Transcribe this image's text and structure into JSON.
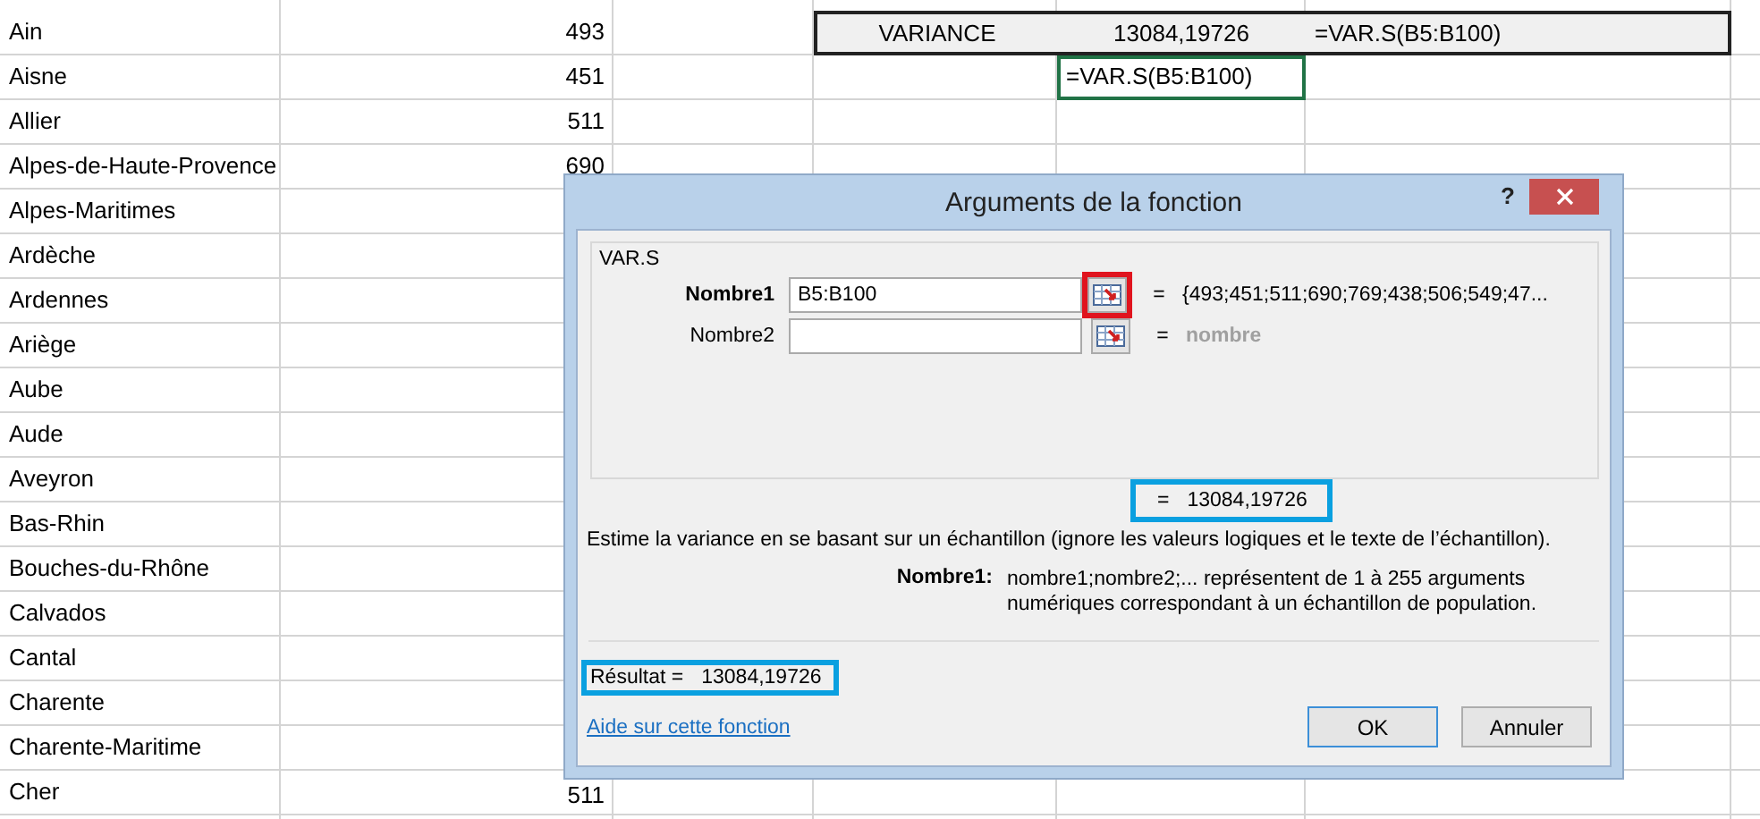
{
  "sheet": {
    "rows": [
      {
        "name": "Ain",
        "value": "493"
      },
      {
        "name": "Aisne",
        "value": "451"
      },
      {
        "name": "Allier",
        "value": "511"
      },
      {
        "name": "Alpes-de-Haute-Provence",
        "value": "690"
      },
      {
        "name": "Alpes-Maritimes"
      },
      {
        "name": "Ardèche"
      },
      {
        "name": "Ardennes"
      },
      {
        "name": "Ariège"
      },
      {
        "name": "Aube"
      },
      {
        "name": "Aude"
      },
      {
        "name": "Aveyron"
      },
      {
        "name": "Bas-Rhin"
      },
      {
        "name": "Bouches-du-Rhône"
      },
      {
        "name": "Calvados"
      },
      {
        "name": "Cantal"
      },
      {
        "name": "Charente"
      },
      {
        "name": "Charente-Maritime"
      },
      {
        "name": "Cher",
        "value": "511"
      }
    ],
    "summary": {
      "label": "VARIANCE",
      "value": "13084,19726",
      "formula": "=VAR.S(B5:B100)"
    },
    "edit_cell": {
      "text": "=VAR.S(B5:B100)",
      "selected": true
    }
  },
  "dialog": {
    "title": "Arguments de la fonction",
    "help": "?",
    "function_name": "VAR.S",
    "arguments": [
      {
        "label": "Nombre1",
        "value": "B5:B100",
        "active": true,
        "equals": "=",
        "result": "{493;451;511;690;769;438;506;549;47...",
        "result_muted": false,
        "highlighted": true
      },
      {
        "label": "Nombre2",
        "active": false,
        "equals": "=",
        "result": "nombre",
        "result_muted": true,
        "highlighted": false
      }
    ],
    "formula_result": {
      "equals": "=",
      "value": "13084,19726",
      "highlighted": true
    },
    "description": "Estime la variance en se basant sur un échantillon (ignore les valeurs logiques et le texte de l’échantillon).",
    "argument_help": {
      "label": "Nombre1:",
      "text": "nombre1;nombre2;... représentent de 1 à 255 arguments numériques correspondant à un échantillon de population."
    },
    "result": {
      "label": "Résultat =",
      "value": "13084,19726",
      "highlighted": true
    },
    "help_link": "Aide sur cette fonction",
    "buttons": [
      {
        "label": "OK",
        "default": true
      },
      {
        "label": "Annuler",
        "default": false
      }
    ]
  }
}
